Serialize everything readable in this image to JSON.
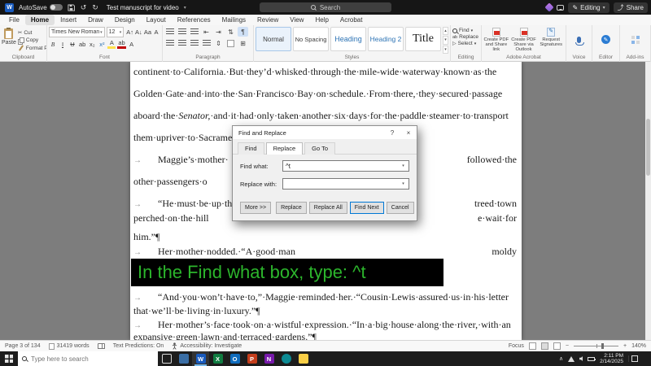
{
  "colors": {
    "overlay_green": "#2cb52c",
    "accent_blue": "#0078d4",
    "word_blue": "#185abd"
  },
  "icons": {
    "chevron_down": "▾",
    "chevron_up": "▴",
    "tab_mark": "→",
    "pilcrow": "¶",
    "scissors": "✂",
    "undo": "↺",
    "redo": "↻",
    "help": "?",
    "close": "×",
    "word_letter": "W",
    "minus": "−",
    "plus": "+",
    "tray_chevron": "∧",
    "gallery_more": "▾"
  },
  "titlebar": {
    "autosave": "AutoSave",
    "doc_title": "Test manuscript for video",
    "search": "Search",
    "comments": "Comments",
    "editing": "Editing",
    "share": "Share"
  },
  "ribbon": {
    "tabs": [
      "File",
      "Home",
      "Insert",
      "Draw",
      "Design",
      "Layout",
      "References",
      "Mailings",
      "Review",
      "View",
      "Help",
      "Acrobat"
    ],
    "active_tab": "Home",
    "clipboard": {
      "paste": "Paste",
      "cut": "Cut",
      "copy": "Copy",
      "format_painter": "Format Painter",
      "label": "Clipboard"
    },
    "font": {
      "name": "Times New Roman",
      "size": "12",
      "row1": [
        "A↑",
        "A↓",
        "Aa",
        "A"
      ],
      "row2": [
        "B",
        "I",
        "U",
        "ab",
        "x₂",
        "x²",
        "A",
        "ab",
        "A"
      ],
      "label": "Font"
    },
    "paragraph": {
      "label": "Paragraph"
    },
    "styles": {
      "items": [
        "Normal",
        "No Spacing",
        "Heading",
        "Heading 2",
        "Title"
      ],
      "label": "Styles"
    },
    "editing_group": {
      "find": "Find",
      "replace": "Replace",
      "select": "Select",
      "label": "Editing"
    },
    "acrobat": {
      "b1": "Create PDF and Share link",
      "b2": "Create PDF Share via Outlook",
      "b3": "Request Signatures",
      "label": "Adobe Acrobat"
    },
    "voice_label": "Voice",
    "editor_label": "Editor",
    "addins_label": "Add-ins"
  },
  "document": {
    "lines": [
      {
        "text": "continent·to·California.·But·they’d·whisked·through·the·mile-wide·waterway·known·as·the"
      },
      {
        "text": "Golden·Gate·and·into·the·San·Francisco·Bay·on·schedule.·From·there,·they·secured·passage"
      },
      {
        "pre": "aboard·the·",
        "italic": "Senator,",
        "post": "·and·it·had·only·taken·another·six·days·for·the·paddle·steamer·to·transport"
      },
      {
        "text": "them·upriver·to·Sacramento.¶"
      },
      {
        "left": "Maggie’s·mother·",
        "right": "followed·the",
        "indent": true
      },
      {
        "left": "other·passengers·o",
        "right": ""
      },
      {
        "left": "“He·must·be·up·th",
        "right": "treed·town",
        "indent": true
      },
      {
        "left": "perched·on·the·hill",
        "right": "e·wait·for"
      },
      {
        "text": "him.”¶"
      },
      {
        "left": "Her·mother·nodded.·“A·good·man",
        "right": "moldy",
        "indent": true
      },
      {
        "text": "“And·you·won’t·have·to,”·Maggie·reminded·her.·“Cousin·Lewis·assured·us·in·his·letter",
        "indent": true
      },
      {
        "text": "that·we’ll·be·living·in·luxury.”¶"
      },
      {
        "text": "Her·mother’s·face·took·on·a·wistful·expression.·“In·a·big·house·along·the·river,·with·an",
        "indent": true
      },
      {
        "text": "expansive·green·lawn·and·terraced·gardens.”¶"
      }
    ]
  },
  "overlay": {
    "instruction": "In the Find what box, type: ^t"
  },
  "dialog": {
    "title": "Find and Replace",
    "tabs": [
      "Find",
      "Replace",
      "Go To"
    ],
    "active_tab": "Replace",
    "find_what_label": "Find what:",
    "find_what_value": "^t",
    "replace_with_label": "Replace with:",
    "replace_with_value": "",
    "buttons": {
      "more": "More >>",
      "replace": "Replace",
      "replace_all": "Replace All",
      "find_next": "Find Next",
      "cancel": "Cancel"
    }
  },
  "statusbar": {
    "page": "Page 3 of 134",
    "words": "31419 words",
    "predictions": "Text Predictions: On",
    "accessibility": "Accessibility: Investigate",
    "focus": "Focus",
    "zoom": "140%"
  },
  "taskbar": {
    "search": "Type here to search",
    "time": "2:11 PM",
    "date": "2/14/2025",
    "apps": [
      {
        "name": "task-view"
      },
      {
        "name": "mail",
        "color": "#3a6ea5"
      },
      {
        "name": "word",
        "letter": "W",
        "color": "#185abd",
        "active": true
      },
      {
        "name": "excel",
        "letter": "X",
        "color": "#107c41"
      },
      {
        "name": "outlook",
        "letter": "O",
        "color": "#0f6cbd"
      },
      {
        "name": "powerpoint",
        "letter": "P",
        "color": "#c43e1c"
      },
      {
        "name": "onenote",
        "letter": "N",
        "color": "#7719aa"
      },
      {
        "name": "edge",
        "color": "#0c8a93",
        "circle": true
      },
      {
        "name": "file-explorer",
        "color": "#f8ce46"
      }
    ]
  }
}
